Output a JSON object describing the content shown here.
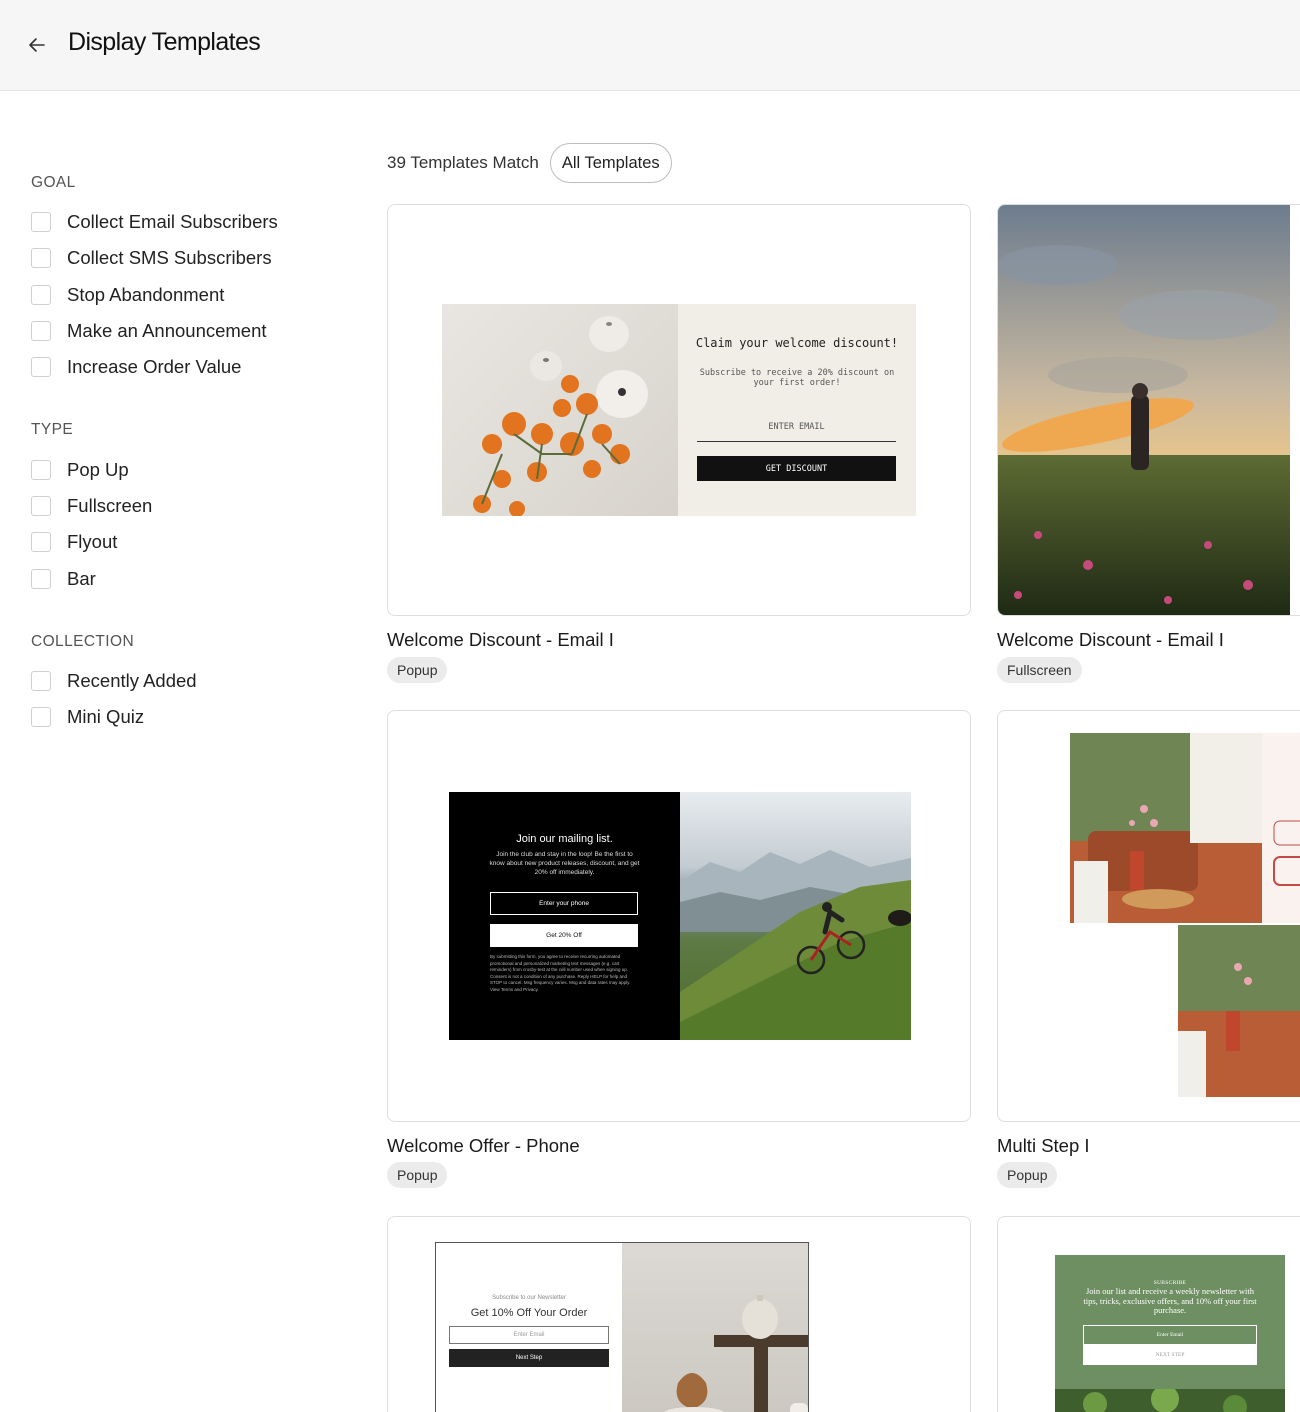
{
  "header": {
    "title": "Display Templates",
    "back_icon": "arrow-left-icon"
  },
  "filters": {
    "goal": {
      "title": "GOAL",
      "options": [
        "Collect Email Subscribers",
        "Collect SMS Subscribers",
        "Stop Abandonment",
        "Make an Announcement",
        "Increase Order Value"
      ]
    },
    "type": {
      "title": "TYPE",
      "options": [
        "Pop Up",
        "Fullscreen",
        "Flyout",
        "Bar"
      ]
    },
    "collection": {
      "title": "COLLECTION",
      "options": [
        "Recently Added",
        "Mini Quiz"
      ]
    }
  },
  "results": {
    "count_label": "39 Templates Match",
    "chip_label": "All Templates"
  },
  "templates": [
    {
      "name": "Welcome Discount - Email I",
      "type": "Popup",
      "preview": {
        "heading": "Claim your welcome discount!",
        "subtext": "Subscribe to receive a 20% discount on your first order!",
        "input_placeholder": "ENTER EMAIL",
        "button": "GET DISCOUNT"
      }
    },
    {
      "name": "Welcome Discount - Email I",
      "type": "Fullscreen"
    },
    {
      "name": "Welcome Offer - Phone",
      "type": "Popup",
      "preview": {
        "heading": "Join our mailing list.",
        "subtext": "Join the club and stay in the loop! Be the first to know about new product releases, discount, and get 20% off immediately.",
        "input_placeholder": "Enter your phone",
        "button": "Get 20% Off",
        "legal": "By submitting this form, you agree to receive recurring automated promotional and personalized marketing text messages (e.g. cart reminders) from crosby-test at the cell number used when signing up. Consent is not a condition of any purchase. Reply HELP for help and STOP to cancel. Msg frequency varies. Msg and data rates may apply. View Terms and Privacy."
      }
    },
    {
      "name": "Multi Step I",
      "type": "Popup"
    },
    {
      "preview": {
        "kicker": "Subscribe to our Newsletter",
        "heading": "Get 10% Off Your Order",
        "input_placeholder": "Enter Email",
        "button": "Next Step"
      }
    },
    {
      "preview": {
        "kicker": "SUBSCRIBE",
        "heading": "Join our list and receive a weekly newsletter with tips, tricks, exclusive offers, and 10% off your first purchase.",
        "input_placeholder": "Enter Email",
        "button": "NEXT STEP"
      }
    }
  ]
}
